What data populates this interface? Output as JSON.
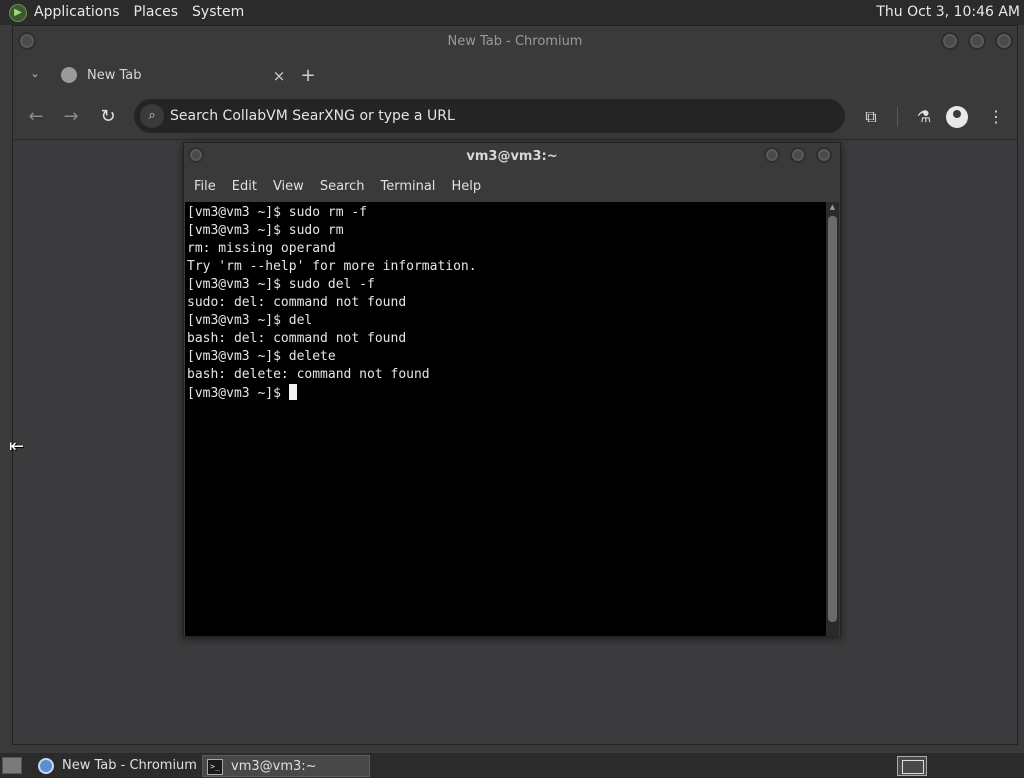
{
  "top_panel": {
    "menus": [
      "Applications",
      "Places",
      "System"
    ],
    "clock": "Thu Oct  3, 10:46 AM"
  },
  "browser": {
    "window_title": "New Tab - Chromium",
    "tab": {
      "title": "New Tab",
      "close": "×"
    },
    "new_tab": "+",
    "omnibox_placeholder": "Search CollabVM SearXNG or type a URL"
  },
  "terminal": {
    "title": "vm3@vm3:~",
    "menu": [
      "File",
      "Edit",
      "View",
      "Search",
      "Terminal",
      "Help"
    ],
    "lines": [
      "[vm3@vm3 ~]$ sudo rm -f",
      "[vm3@vm3 ~]$ sudo rm",
      "rm: missing operand",
      "Try 'rm --help' for more information.",
      "[vm3@vm3 ~]$ sudo del -f",
      "sudo: del: command not found",
      "[vm3@vm3 ~]$ del",
      "bash: del: command not found",
      "[vm3@vm3 ~]$ delete",
      "bash: delete: command not found"
    ],
    "prompt": "[vm3@vm3 ~]$ "
  },
  "taskbar": {
    "tasks": [
      "New Tab - Chromium",
      "vm3@vm3:~"
    ]
  },
  "icons": {
    "apps": "apps-logo-icon",
    "globe": "globe-icon",
    "search": "search-icon",
    "extensions": "puzzle-icon",
    "labs": "flask-icon",
    "profile": "person-icon",
    "menu": "kebab-icon"
  }
}
